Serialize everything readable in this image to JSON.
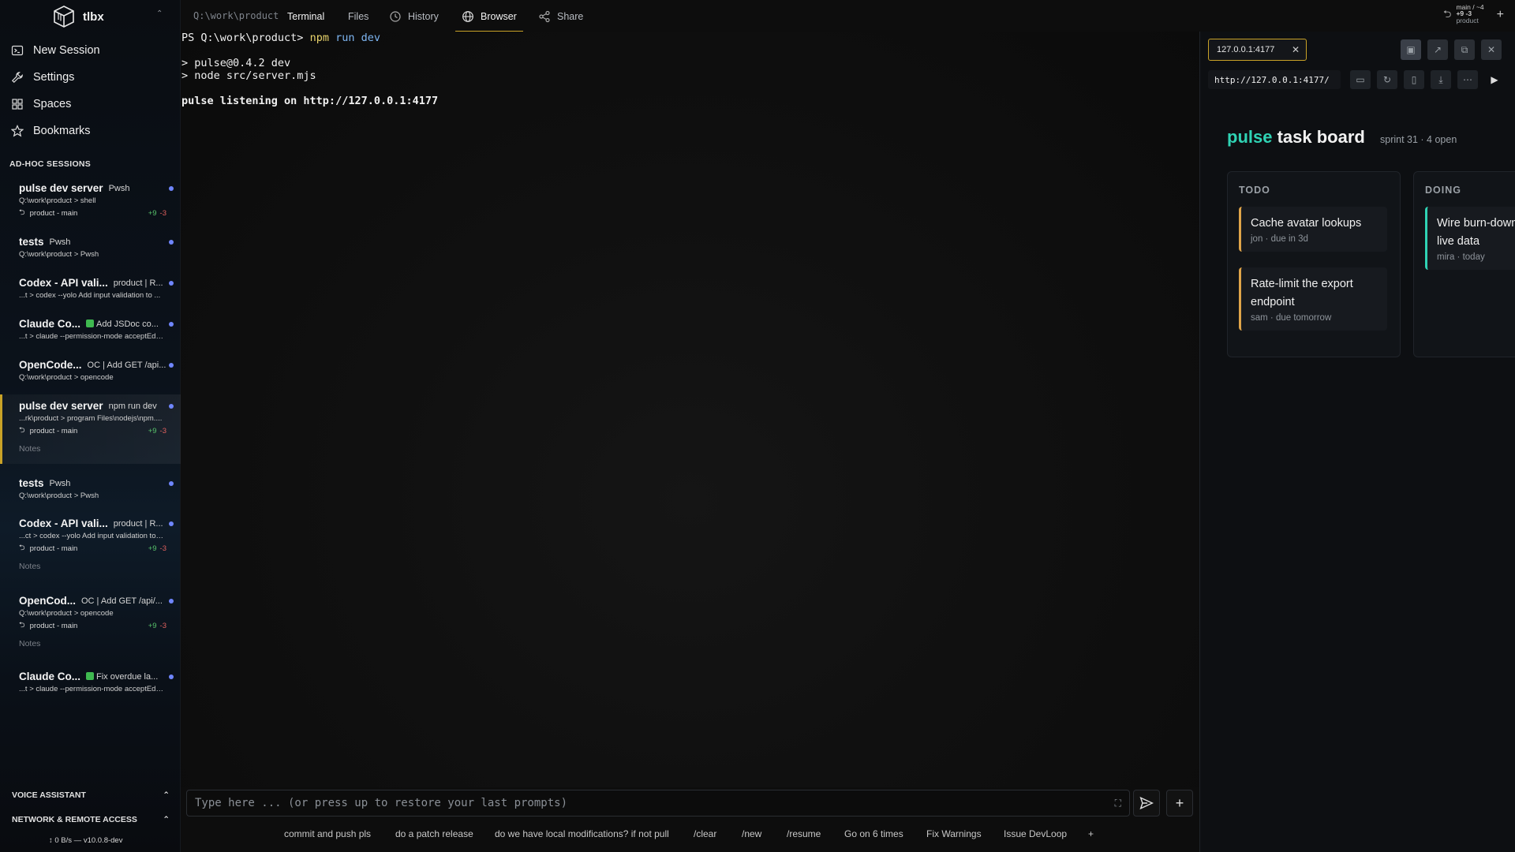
{
  "app": {
    "name": "tlbx"
  },
  "nav": {
    "new_session": "New Session",
    "settings": "Settings",
    "spaces": "Spaces",
    "bookmarks": "Bookmarks"
  },
  "sessions_title": "AD-HOC SESSIONS",
  "sessions": [
    {
      "title": "pulse dev server",
      "tag": "Pwsh",
      "line": "Q:\\work\\product > shell",
      "branch": "product - main",
      "plus": "+9",
      "minus": "-3"
    },
    {
      "title": "tests",
      "tag": "Pwsh",
      "line": "Q:\\work\\product > Pwsh"
    },
    {
      "title": "Codex - API vali...",
      "tag": "product | R...",
      "line": "...t > codex --yolo Add input validation to ..."
    },
    {
      "title": "Claude Co...",
      "tag": "Add JSDoc co...",
      "line": "...t > claude --permission-mode acceptEdi..."
    },
    {
      "title": "OpenCode...",
      "tag": "OC | Add GET /api...",
      "line": "Q:\\work\\product > opencode"
    },
    {
      "title": "pulse dev server",
      "tag": "npm run dev",
      "line": "...rk\\product > program Files\\nodejs\\npm....",
      "branch": "product - main",
      "plus": "+9",
      "minus": "-3",
      "notes": "Notes"
    },
    {
      "title": "tests",
      "tag": "Pwsh",
      "line": "Q:\\work\\product > Pwsh"
    },
    {
      "title": "Codex - API vali...",
      "tag": "product | R...",
      "line": "...ct > codex --yolo Add input validation to ...",
      "branch": "product - main",
      "plus": "+9",
      "minus": "-3",
      "notes": "Notes"
    },
    {
      "title": "OpenCod...",
      "tag": "OC | Add GET /api/...",
      "line": "Q:\\work\\product > opencode",
      "branch": "product - main",
      "plus": "+9",
      "minus": "-3",
      "notes": "Notes"
    },
    {
      "title": "Claude Co...",
      "tag": "Fix overdue la...",
      "line": "...t > claude --permission-mode acceptEdi..."
    }
  ],
  "bottom": {
    "voice": "VOICE ASSISTANT",
    "network": "NETWORK & REMOTE ACCESS",
    "status": "↕ 0 B/s  —  v10.0.8-dev"
  },
  "topbar": {
    "path": "Q:\\work\\product",
    "tabs": {
      "terminal": "Terminal",
      "files": "Files",
      "history": "History",
      "browser": "Browser",
      "share": "Share"
    },
    "git": {
      "branch": "main / ~4",
      "diff": "+9 -3",
      "repo": "product"
    }
  },
  "terminal": {
    "prompt": "PS Q:\\work\\product>",
    "cmd1": "npm",
    "cmd2": "run dev",
    "out1": "> pulse@0.4.2 dev",
    "out2": "> node src/server.mjs",
    "out3": "pulse listening on http://127.0.0.1:4177"
  },
  "input": {
    "placeholder": "Type here ... (or press up to restore your last prompts)"
  },
  "quick_actions": [
    "commit and push pls",
    "do a patch release",
    "do we have local modifications? if not pull",
    "/clear",
    "/new",
    "/resume",
    "Go on 6 times",
    "Fix Warnings",
    "Issue DevLoop",
    "+"
  ],
  "browser": {
    "tab_label": "127.0.0.1:4177",
    "url": "http://127.0.0.1:4177/",
    "page": {
      "title_accent": "pulse",
      "title_rest": "task board",
      "subtitle": "sprint 31 · 4 open",
      "columns": {
        "todo": {
          "name": "TODO",
          "cards": [
            {
              "title": "Cache avatar lookups",
              "meta": "jon · due in 3d"
            },
            {
              "title": "Rate-limit the export endpoint",
              "meta": "sam · due tomorrow"
            }
          ]
        },
        "doing": {
          "name": "DOING",
          "cards": [
            {
              "title": "Wire burn-down to live data",
              "meta": "mira · today"
            }
          ]
        }
      }
    }
  },
  "colors": {
    "accent": "#c9a227",
    "teal": "#2fd3b4",
    "session_dot": "#6f86ff",
    "todo_border": "#e0a54a"
  }
}
